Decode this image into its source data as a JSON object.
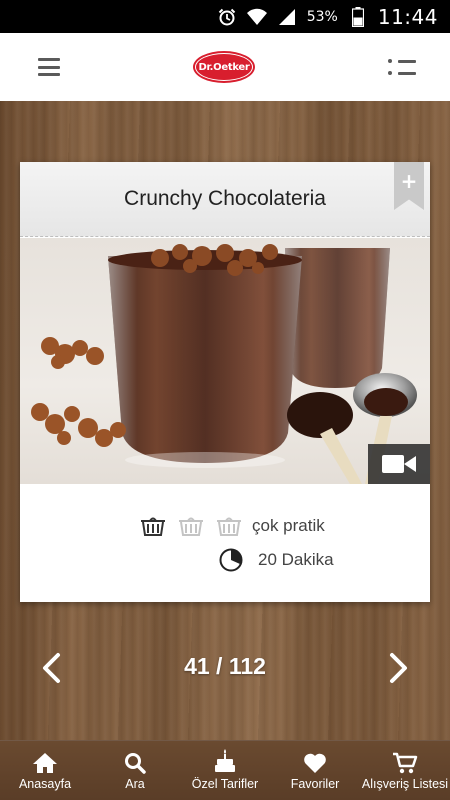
{
  "status_bar": {
    "battery_percent": "53%",
    "time": "11:44"
  },
  "app_bar": {
    "logo_text": "Dr.Oetker"
  },
  "recipe": {
    "title": "Crunchy Chocolateria",
    "difficulty_label": "çok pratik",
    "difficulty_level": 1,
    "difficulty_max": 3,
    "time_label": "20 Dakika"
  },
  "pager": {
    "label": "41 / 112"
  },
  "bottom_nav": {
    "items": [
      {
        "label": "Anasayfa",
        "icon": "home-icon"
      },
      {
        "label": "Ara",
        "icon": "search-icon"
      },
      {
        "label": "Özel Tarifler",
        "icon": "cake-icon"
      },
      {
        "label": "Favoriler",
        "icon": "heart-icon"
      },
      {
        "label": "Alışveriş Listesi",
        "icon": "cart-icon"
      }
    ]
  },
  "colors": {
    "brand_red": "#d81e2e",
    "wood": "#7a5a3e",
    "icon_gray": "#5a5a5a"
  }
}
